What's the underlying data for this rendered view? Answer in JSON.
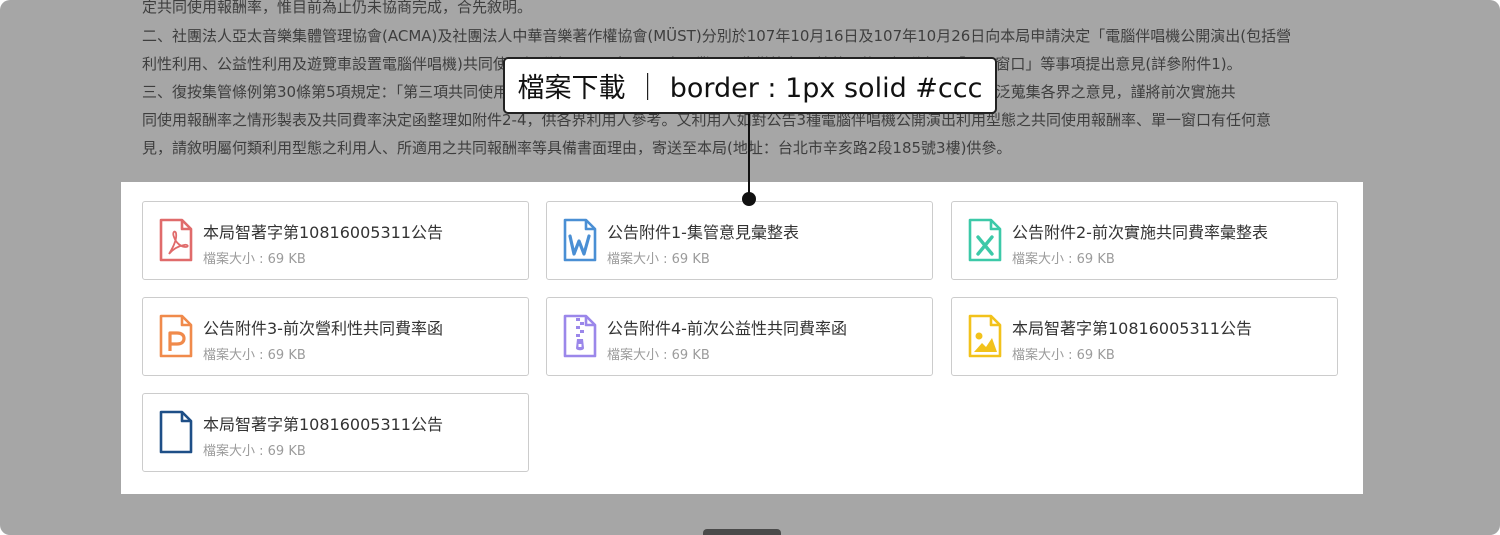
{
  "article": {
    "line0": "定共同使用報酬率，惟目前為止仍未協商完成，合先敘明。",
    "line1": "二、社團法人亞太音樂集體管理協會(ACMA)及社團法人中華音樂著作權協會(MÜST)分別於107年10月16日及107年10月26日向本局申請決定「電腦伴唱機公開演出(包括營",
    "line2": "利性利用、公益性利用及遊覽車設置電腦伴唱機)共同使用報酬率及單一窗口」，本局業已公告徵詢各界就共同使用報酬率及「單一窗口」等事項提出意見(詳參附件1)。",
    "line3": "三、復按集管條例第30條第5項規定：「第三項共同使用報酬率及單一窗口之決定，著作財產權專責機關應公告並通知……」，為廣泛蒐集各界之意見，謹將前次實施共",
    "line4": "同使用報酬率之情形製表及共同費率決定函整理如附件2-4，供各界利用人參考。又利用人如對公告3種電腦伴唱機公開演出利用型態之共同使用報酬率、單一窗口有任何意",
    "line5": "見，請敘明屬何類利用型態之利用人、所適用之共同報酬率等具備書面理由，寄送至本局(地址：台北市辛亥路2段185號3樓)供參。"
  },
  "callout": {
    "text": "檔案下載 ｜ border : 1px solid #ccc"
  },
  "files": [
    {
      "name": "本局智著字第10816005311公告",
      "size": "檔案大小 : 69 KB",
      "icon": "pdf-file-icon",
      "color": "#e06b6b"
    },
    {
      "name": "公告附件1-集管意見彙整表",
      "size": "檔案大小 : 69 KB",
      "icon": "word-file-icon",
      "color": "#4a8fd4"
    },
    {
      "name": "公告附件2-前次實施共同費率彙整表",
      "size": "檔案大小 : 69 KB",
      "icon": "excel-file-icon",
      "color": "#3cc9a8"
    },
    {
      "name": "公告附件3-前次營利性共同費率函",
      "size": "檔案大小 : 69 KB",
      "icon": "powerpoint-file-icon",
      "color": "#f08a4b"
    },
    {
      "name": "公告附件4-前次公益性共同費率函",
      "size": "檔案大小 : 69 KB",
      "icon": "zip-file-icon",
      "color": "#9b87ea"
    },
    {
      "name": "本局智著字第10816005311公告",
      "size": "檔案大小 : 69 KB",
      "icon": "image-file-icon",
      "color": "#f2c21b"
    },
    {
      "name": "本局智著字第10816005311公告",
      "size": "檔案大小 : 69 KB",
      "icon": "generic-file-icon",
      "color": "#1e4f87"
    }
  ],
  "colors": {
    "overlay": "#a6a6a6",
    "card_border": "#cccccc",
    "panel": "#ffffff"
  }
}
